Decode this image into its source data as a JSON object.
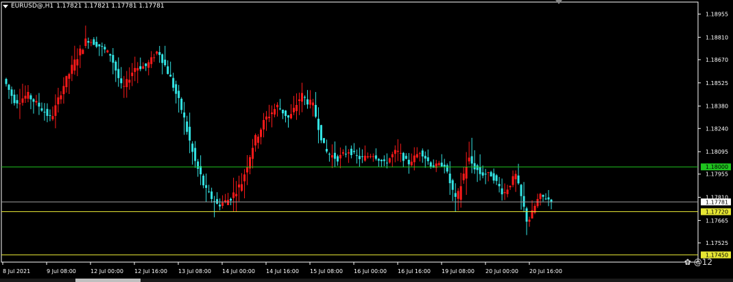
{
  "header": {
    "symbol": "EURUSD@,H1",
    "ohlc": "1.17821 1.17821 1.17781 1.17781"
  },
  "watermark": "@12",
  "colors": {
    "bull": "#ff1a1a",
    "bear": "#33e6e6",
    "green_line": "#1fc41f",
    "yellow_line": "#e6e633",
    "grid_line": "#a0a0a0"
  },
  "chart_data": {
    "type": "candlestick",
    "ylim": [
      1.17405,
      1.1903
    ],
    "y_ticks": [
      "1.18955",
      "1.18810",
      "1.18670",
      "1.18525",
      "1.18380",
      "1.18240",
      "1.18095",
      "1.17955",
      "1.17810",
      "1.17665",
      "1.17525"
    ],
    "x_labels": [
      "8 Jul 2021",
      "9 Jul 08:00",
      "12 Jul 00:00",
      "12 Jul 16:00",
      "13 Jul 08:00",
      "14 Jul 00:00",
      "14 Jul 16:00",
      "15 Jul 08:00",
      "16 Jul 00:00",
      "16 Jul 16:00",
      "19 Jul 08:00",
      "20 Jul 00:00",
      "20 Jul 16:00"
    ],
    "level_lines": [
      {
        "value": 1.18,
        "label": "1.18000",
        "style": "green"
      },
      {
        "value": 1.1772,
        "label": "1.17720",
        "style": "yellow"
      },
      {
        "value": 1.1745,
        "label": "1.17450",
        "style": "yellow"
      }
    ],
    "current_price": {
      "value": 1.17781,
      "label": "1.17781"
    },
    "anchors": [
      1.1855,
      1.184,
      1.1845,
      1.1838,
      1.183,
      1.185,
      1.1866,
      1.188,
      1.1876,
      1.187,
      1.1848,
      1.1862,
      1.1863,
      1.1873,
      1.1856,
      1.1835,
      1.1805,
      1.1785,
      1.1776,
      1.178,
      1.179,
      1.1815,
      1.183,
      1.1838,
      1.183,
      1.1845,
      1.1838,
      1.181,
      1.1805,
      1.181,
      1.1805,
      1.1808,
      1.1802,
      1.181,
      1.1802,
      1.181,
      1.18,
      1.1802,
      1.1778,
      1.1805,
      1.1796,
      1.1795,
      1.1783,
      1.1795,
      1.1765,
      1.1782,
      1.1779
    ],
    "volatility": [
      4,
      6,
      5,
      5,
      5,
      6,
      6,
      5,
      4,
      5,
      5,
      5,
      4,
      6,
      6,
      7,
      8,
      6,
      5,
      6,
      7,
      7,
      6,
      5,
      5,
      7,
      6,
      6,
      5,
      4,
      4,
      4,
      4,
      5,
      4,
      4,
      4,
      4,
      6,
      9,
      6,
      4,
      5,
      5,
      6,
      4,
      3
    ]
  }
}
